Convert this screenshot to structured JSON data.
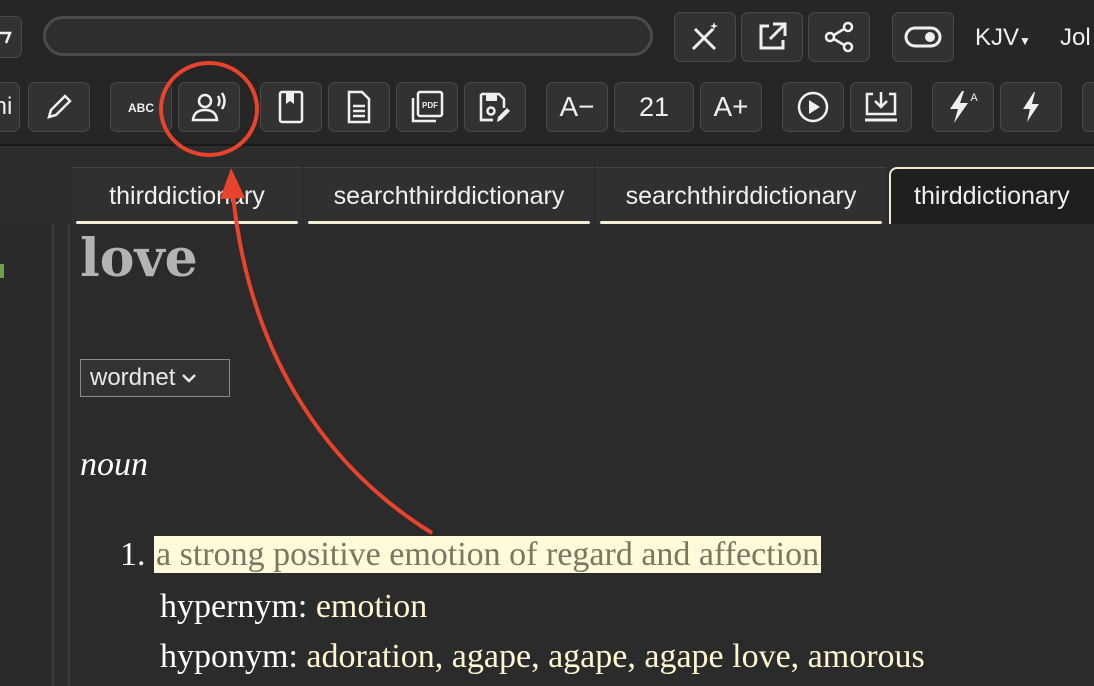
{
  "toolbar_top": {
    "bible_version": "KJV",
    "book_partial": "Jol",
    "search_value": ""
  },
  "toolbar_second": {
    "left_partial_label": "hi",
    "font_size_decrease": "A−",
    "font_size_value": "21",
    "font_size_increase": "A+"
  },
  "tabs": [
    {
      "label": "thirddictionary"
    },
    {
      "label": "searchthirddictionary"
    },
    {
      "label": "searchthirddictionary"
    },
    {
      "label": "thirddictionary"
    }
  ],
  "entry": {
    "headword": "love",
    "dictionary_select": "wordnet",
    "part_of_speech": "noun",
    "sense_number": "1.",
    "definition": "a strong positive emotion of regard and affection",
    "hypernym_label": "hypernym:",
    "hypernym_value": "emotion",
    "hyponym_label": "hyponym:",
    "hyponym_value": "adoration, agape, agape, agape love, amorous"
  },
  "annotation": {
    "color": "#e8432d"
  }
}
